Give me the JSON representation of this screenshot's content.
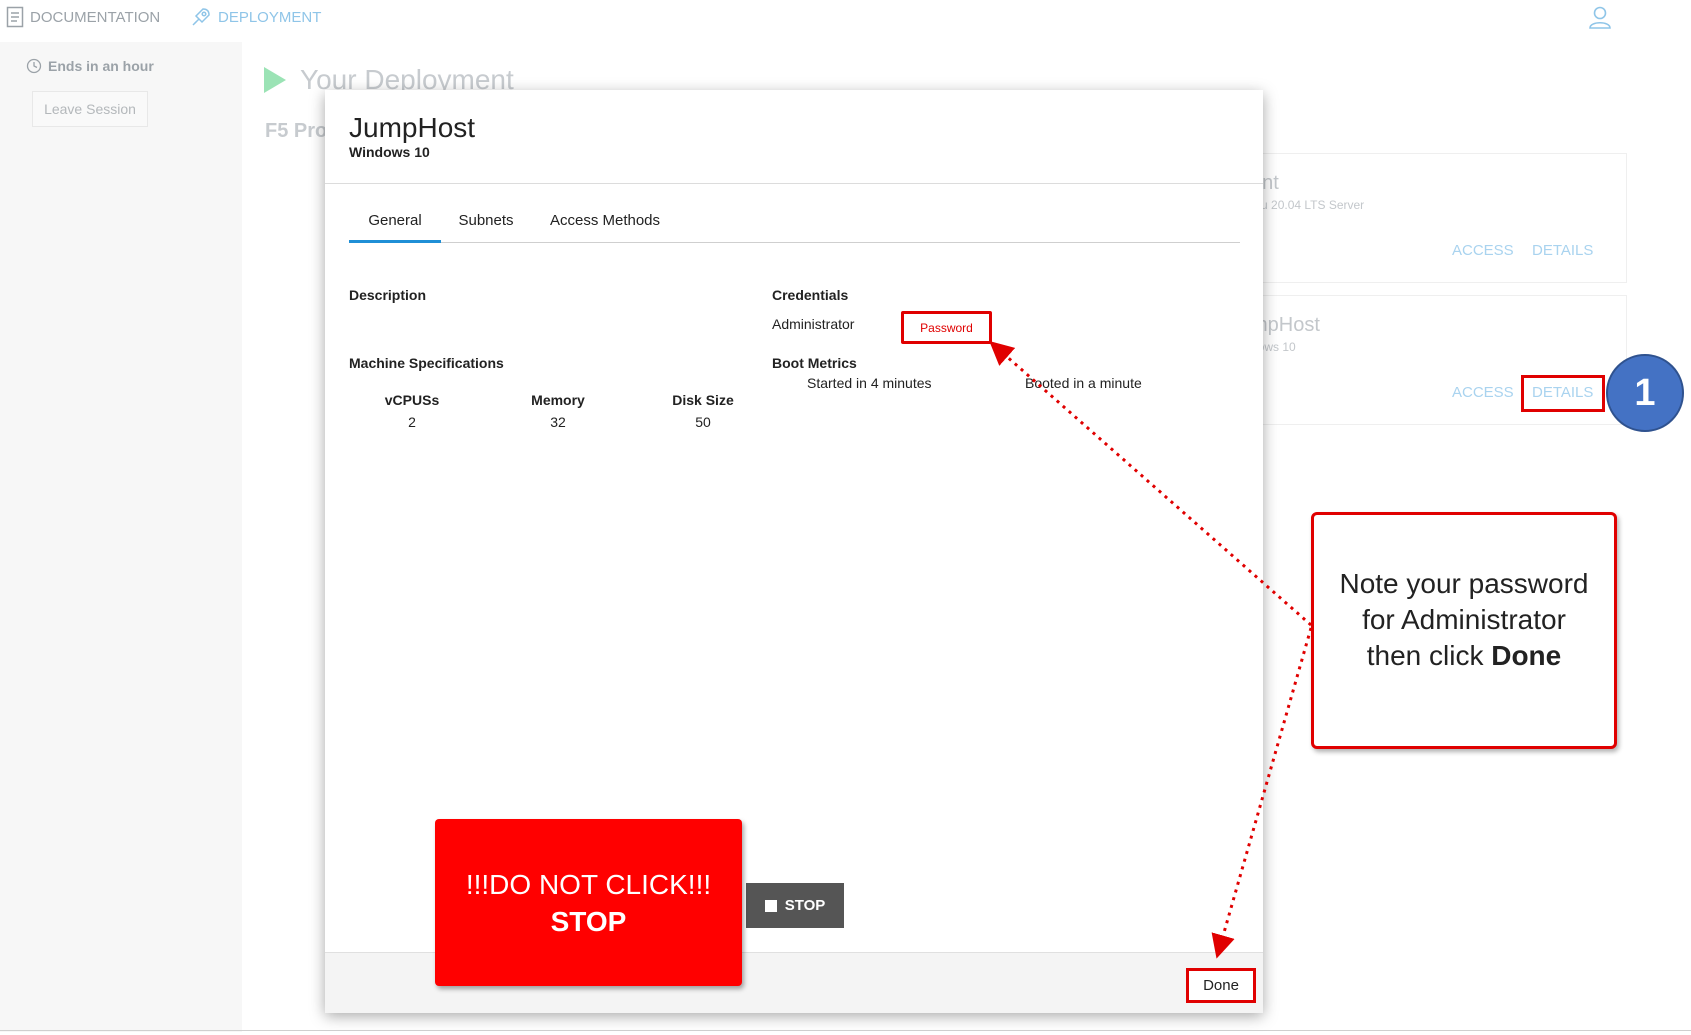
{
  "nav": {
    "documentation": "DOCUMENTATION",
    "deployment": "DEPLOYMENT"
  },
  "sidebar": {
    "timer": "Ends in an hour",
    "leave": "Leave Session"
  },
  "deployment": {
    "title": "Your Deployment",
    "project": "F5 Pro"
  },
  "background_cards": [
    {
      "title": "ent",
      "subtitle": "ntu 20.04 LTS Server",
      "access": "ACCESS",
      "details": "DETAILS"
    },
    {
      "title": "mpHost",
      "subtitle": "dows 10",
      "access": "ACCESS",
      "details": "DETAILS"
    }
  ],
  "modal": {
    "title": "JumpHost",
    "subtitle": "Windows 10",
    "tabs": [
      "General",
      "Subnets",
      "Access Methods"
    ],
    "active_tab": "General",
    "description_label": "Description",
    "machine_specs_label": "Machine Specifications",
    "specs": [
      {
        "label": "vCPUSs",
        "value": "2"
      },
      {
        "label": "Memory",
        "value": "32"
      },
      {
        "label": "Disk Size",
        "value": "50"
      }
    ],
    "credentials_label": "Credentials",
    "credentials_user": "Administrator",
    "password_button": "Password",
    "boot_metrics_label": "Boot Metrics",
    "boot_started": "Started in 4 minutes",
    "boot_booted": "Booted in a minute",
    "stop_button": "STOP",
    "done_button": "Done"
  },
  "annotations": {
    "warning_line1": "!!!DO NOT CLICK!!!",
    "warning_line2": "STOP",
    "note_line1": "Note your password",
    "note_line2": "for Administrator",
    "note_line3_prefix": "then click ",
    "note_line3_bold": "Done",
    "step_number": "1"
  },
  "colors": {
    "accent_blue": "#1f8fd6",
    "annotation_red": "#e00000",
    "warning_red": "#ff0000",
    "step_circle": "#4472c4",
    "stop_button": "#555555"
  }
}
